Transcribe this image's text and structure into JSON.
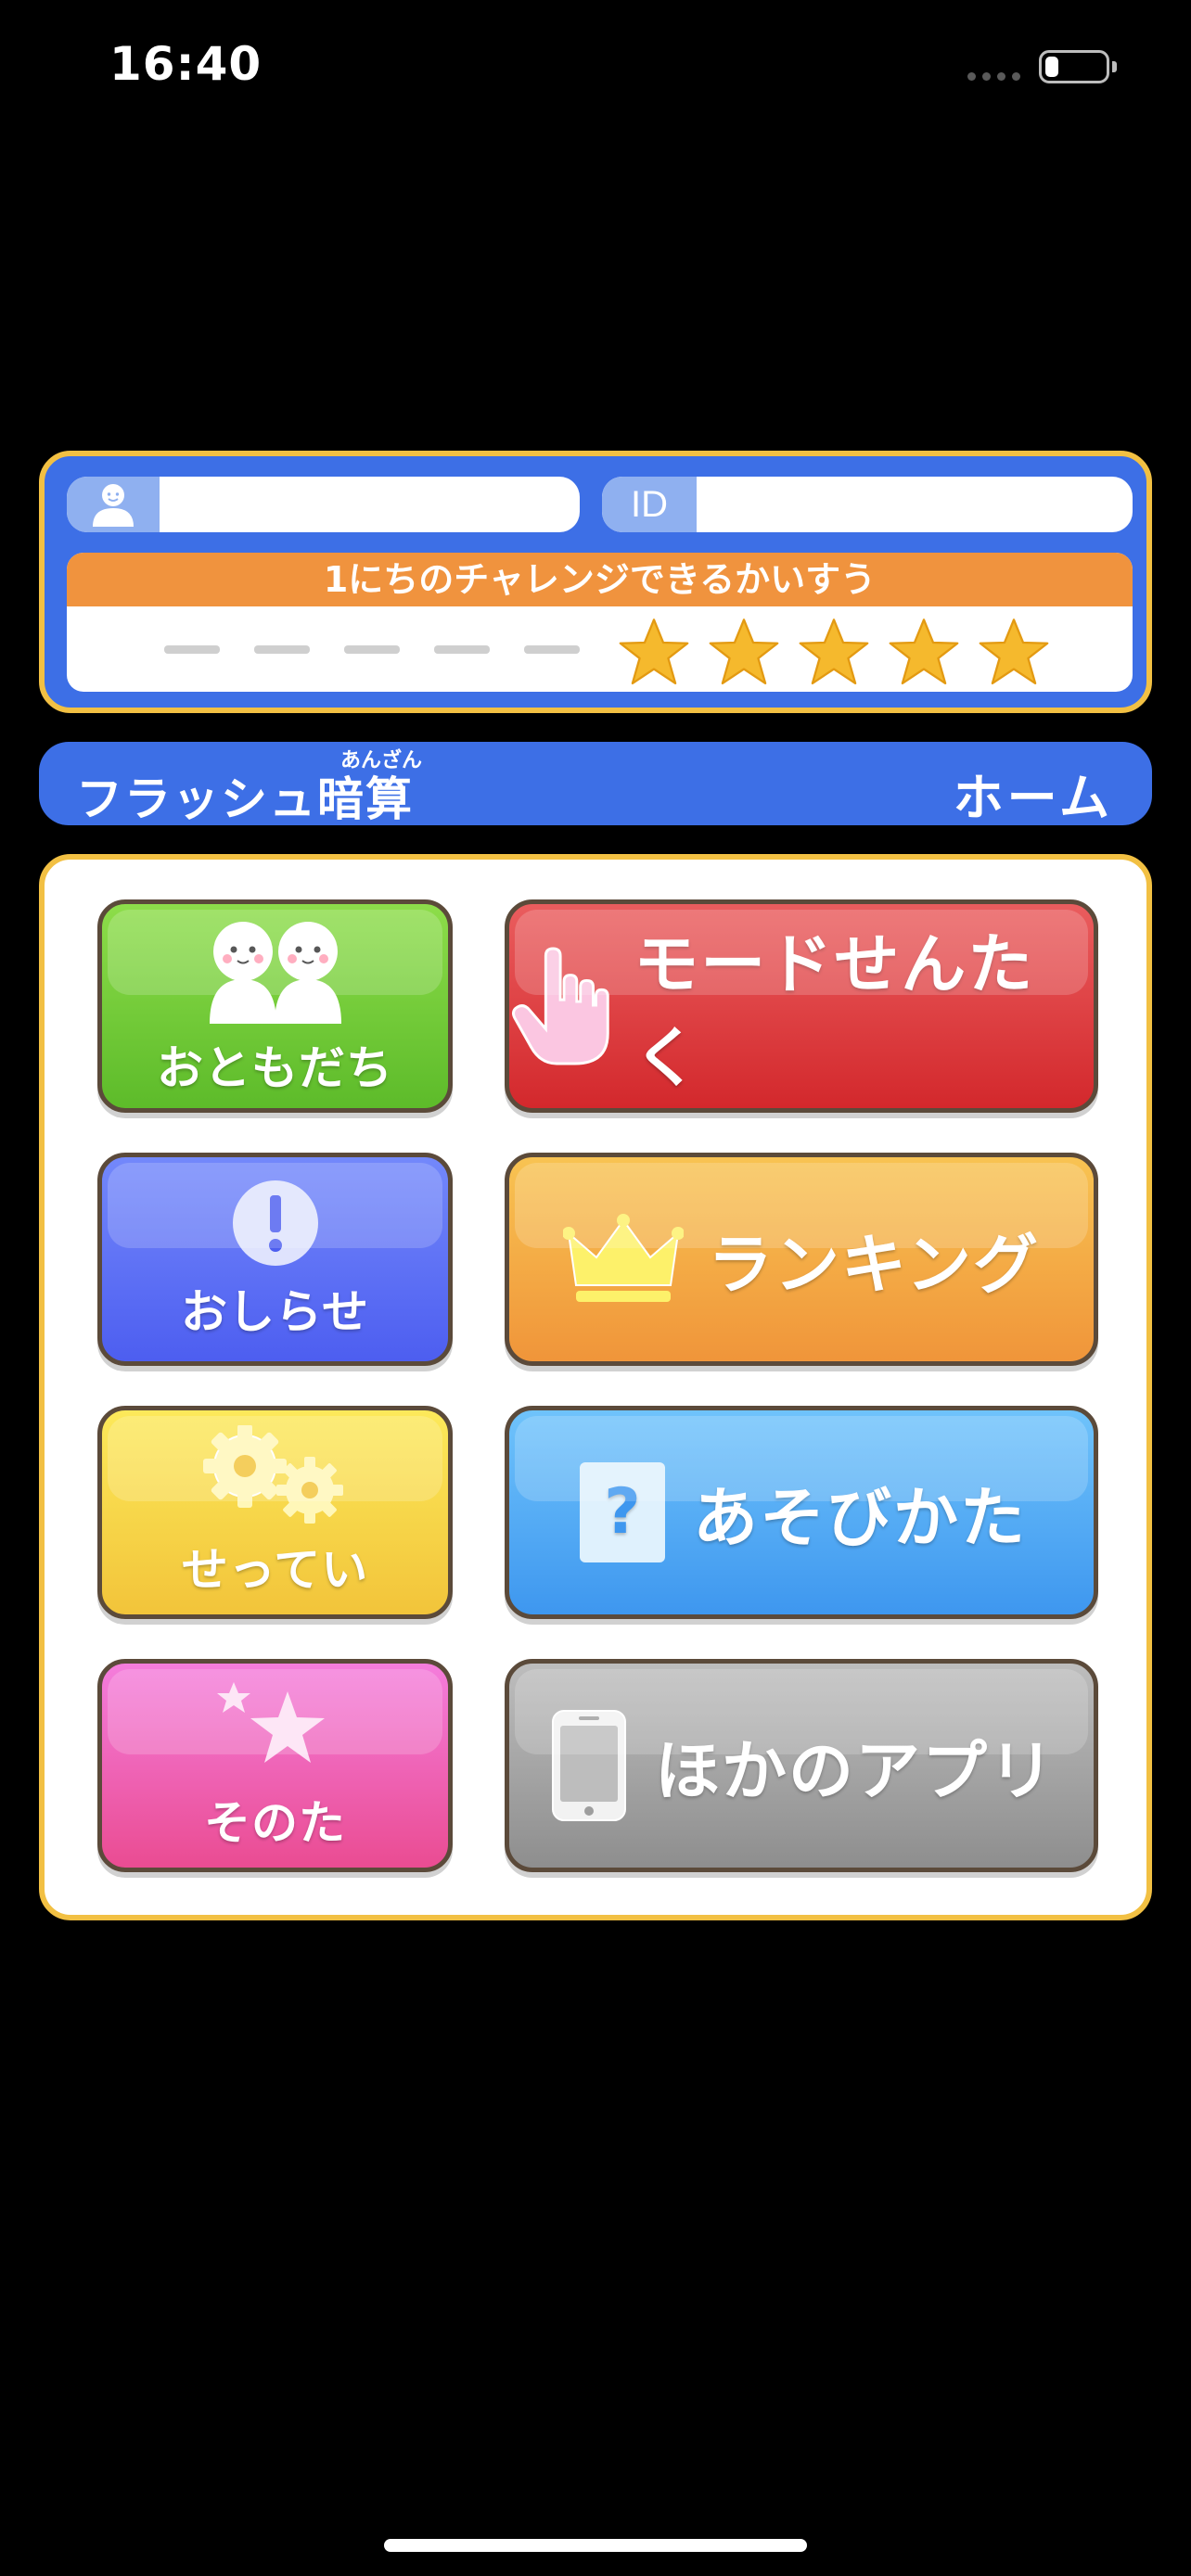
{
  "status_bar": {
    "time": "16:40",
    "battery_level": 0.22
  },
  "profile": {
    "name_value": "",
    "id_label": "ID",
    "id_value": "",
    "challenge_title": "1にちのチャレンジできるかいすう",
    "used_count": 5,
    "remaining_count": 5
  },
  "header": {
    "app_title": "フラッシュ暗算",
    "app_title_ruby": "あんざん",
    "screen_title": "ホーム"
  },
  "menu": {
    "friends": "おともだち",
    "mode_select": "モードせんたく",
    "news": "おしらせ",
    "ranking": "ランキング",
    "settings": "せってい",
    "how_to_play": "あそびかた",
    "other": "そのた",
    "other_apps": "ほかのアプリ"
  },
  "colors": {
    "accent_blue": "#3d6fe6",
    "border_gold": "#f2c043",
    "challenge_orange": "#f0933e",
    "star_gold": "#f5b92d"
  }
}
